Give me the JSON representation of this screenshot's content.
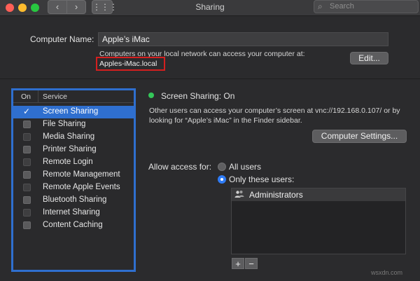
{
  "window": {
    "title": "Sharing",
    "search_placeholder": "Search",
    "nav_back": "‹",
    "nav_forward": "›",
    "grid_icon": "⋮⋮⋮"
  },
  "computer_name": {
    "label": "Computer Name:",
    "value": "Apple’s iMac",
    "info": "Computers on your local network can access your computer at:",
    "local_name": "Apples-iMac.local",
    "edit_button": "Edit..."
  },
  "services": {
    "header_on": "On",
    "header_service": "Service",
    "items": [
      {
        "label": "Screen Sharing",
        "checked": true,
        "selected": true
      },
      {
        "label": "File Sharing",
        "checked": false
      },
      {
        "label": "Media Sharing",
        "checked": false
      },
      {
        "label": "Printer Sharing",
        "checked": false
      },
      {
        "label": "Remote Login",
        "checked": false
      },
      {
        "label": "Remote Management",
        "checked": false
      },
      {
        "label": "Remote Apple Events",
        "checked": false
      },
      {
        "label": "Bluetooth Sharing",
        "checked": false
      },
      {
        "label": "Internet Sharing",
        "checked": false
      },
      {
        "label": "Content Caching",
        "checked": false
      }
    ]
  },
  "detail": {
    "status": "Screen Sharing: On",
    "status_color": "#34c759",
    "description_line1": "Other users can access your computer’s screen at vnc://192.168.0.107/ or by",
    "description_line2": "looking for “Apple’s iMac” in the Finder sidebar.",
    "computer_settings_button": "Computer Settings...",
    "allow_access_label": "Allow access for:",
    "option_all_users": "All users",
    "option_only_these": "Only these users:",
    "users": [
      "Administrators"
    ],
    "add_button": "+",
    "remove_button": "−"
  },
  "watermark": "wsxdn.com",
  "colors": {
    "accent": "#2f6fcf",
    "highlight_box": "#d41f1f"
  }
}
